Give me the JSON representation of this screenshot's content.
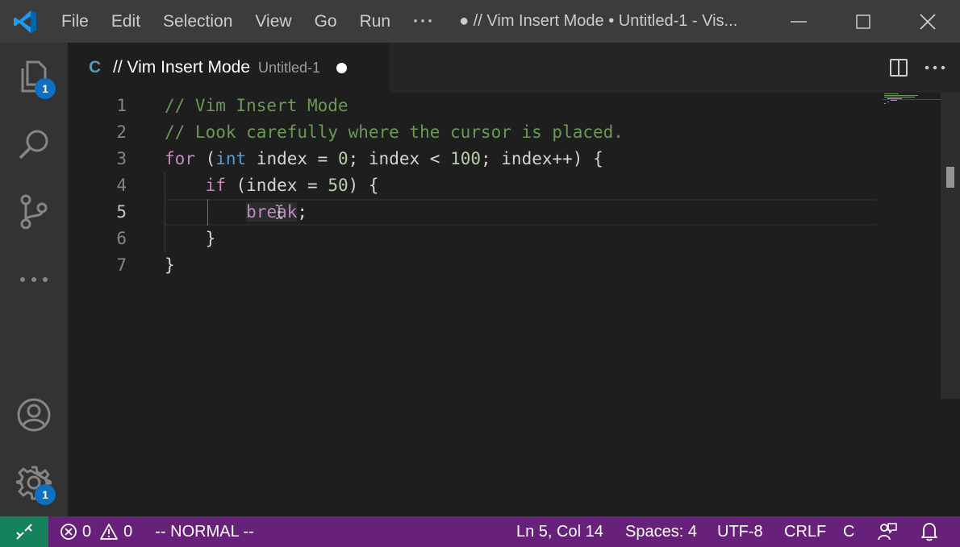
{
  "titlebar": {
    "menu": [
      "File",
      "Edit",
      "Selection",
      "View",
      "Go",
      "Run"
    ],
    "more": "···",
    "window_title": "● // Vim Insert Mode • Untitled-1 - Vis..."
  },
  "activity": {
    "explorer_badge": "1",
    "settings_badge": "1"
  },
  "tab": {
    "lang": "C",
    "name": "// Vim Insert Mode",
    "description": "Untitled-1"
  },
  "editor": {
    "line_numbers": [
      "1",
      "2",
      "3",
      "4",
      "5",
      "6",
      "7"
    ],
    "active_line": 5,
    "lines": {
      "l1": "// Vim Insert Mode",
      "l2": "// Look carefully where the cursor is placed.",
      "l3": {
        "kw_for": "for",
        "p1": " (",
        "ty_int": "int",
        "id1": " index = ",
        "n0": "0",
        "p2": "; index < ",
        "n100": "100",
        "p3": "; index++) {"
      },
      "l4": {
        "indent": "    ",
        "kw_if": "if",
        "p1": " (index = ",
        "n50": "50",
        "p2": ") {"
      },
      "l5": {
        "indent": "        ",
        "kw_break": "break",
        "p1": ";"
      },
      "l6": "    }",
      "l7": "}"
    }
  },
  "statusbar": {
    "errors": "0",
    "warnings": "0",
    "mode": "-- NORMAL --",
    "position": "Ln 5, Col 14",
    "spaces": "Spaces: 4",
    "encoding": "UTF-8",
    "eol": "CRLF",
    "language": "C"
  },
  "colors": {
    "status_bar": "#68217a",
    "remote": "#16825d",
    "badge": "#0e70c0",
    "comment": "#6a9955",
    "keyword": "#c586c0",
    "type": "#569cd6",
    "number": "#b5cea8"
  }
}
